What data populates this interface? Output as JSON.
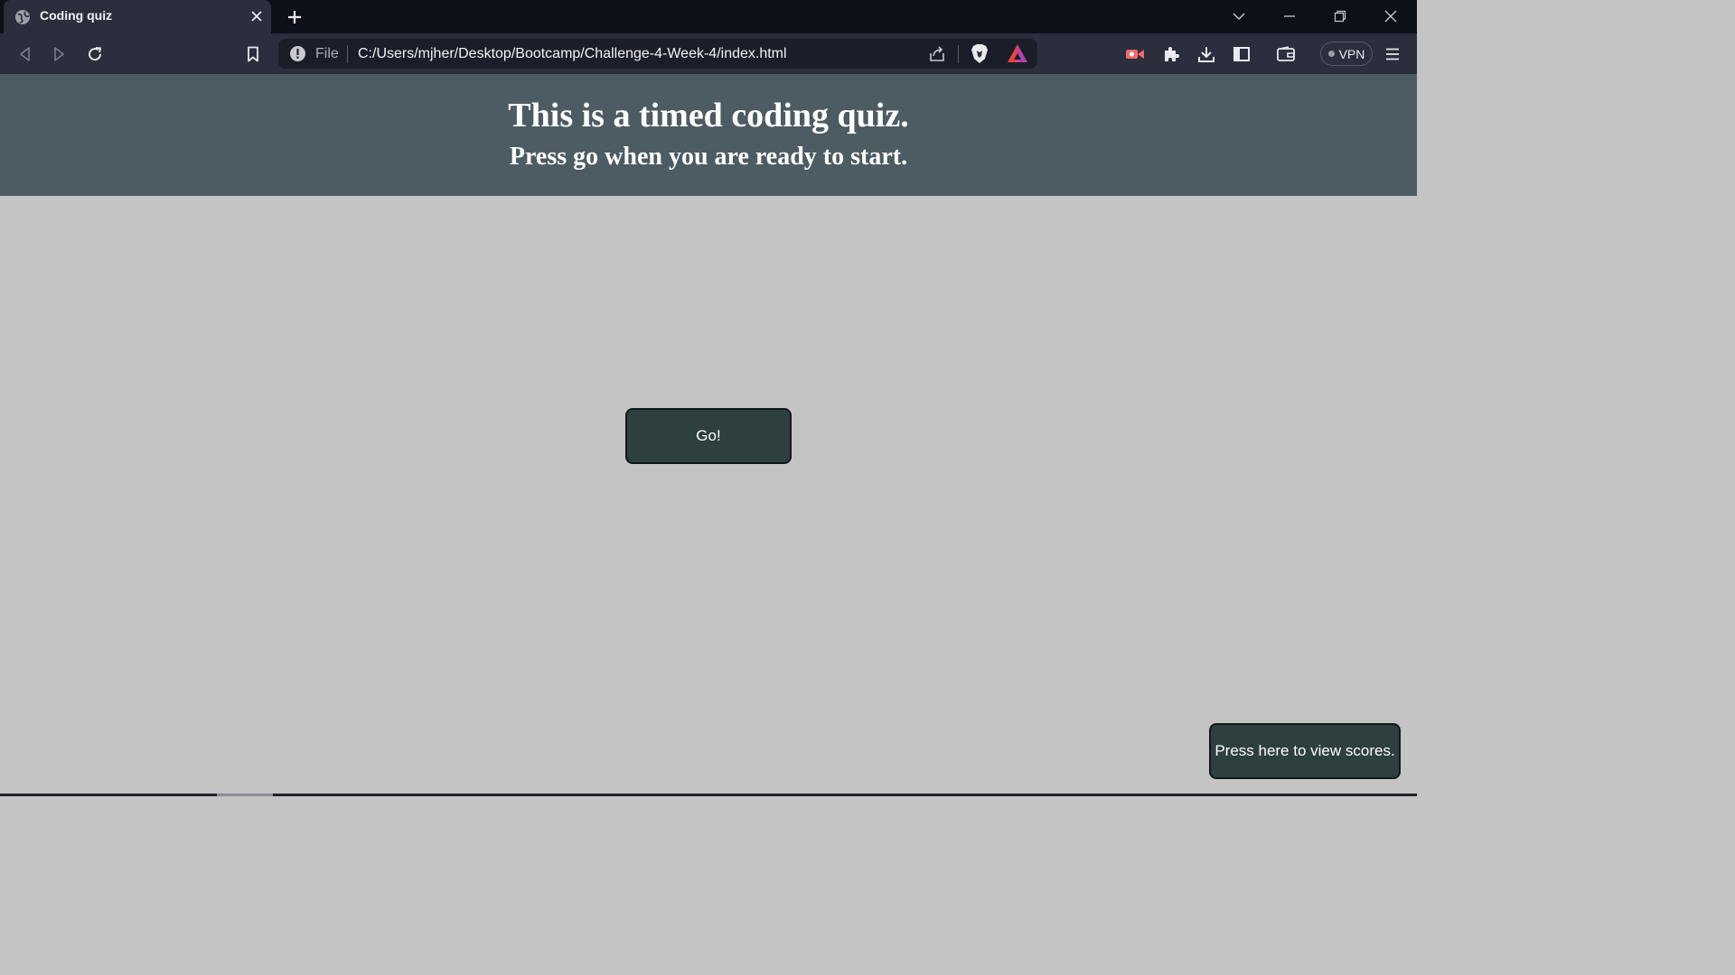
{
  "browser": {
    "tab": {
      "title": "Coding quiz"
    },
    "address_bar": {
      "scheme_label": "File",
      "url": "C:/Users/mjher/Desktop/Bootcamp/Challenge-4-Week-4/index.html"
    },
    "vpn_label": "VPN",
    "colors": {
      "tabstrip": "#0e1019",
      "toolbar": "#2a2e3d",
      "omnibox": "#1b1e29"
    }
  },
  "page": {
    "header": {
      "title": "This is a timed coding quiz.",
      "subtitle": "Press go when you are ready to start."
    },
    "go_button_label": "Go!",
    "scores_button_label": "Press here to view scores.",
    "colors": {
      "header_bg": "#4d5b63",
      "body_bg": "#c4c4c4",
      "button_bg": "#2d3f3e"
    }
  }
}
